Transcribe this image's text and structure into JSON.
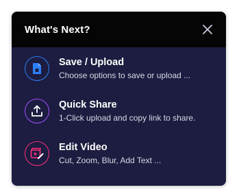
{
  "dialog": {
    "title": "What's Next?",
    "close_icon": "close-icon"
  },
  "options": [
    {
      "title": "Save / Upload",
      "description": "Choose options to save or upload ...",
      "icon": "file-save-icon",
      "accent": "#2d7ff9"
    },
    {
      "title": "Quick Share",
      "description": "1-Click upload and copy link to share.",
      "icon": "upload-share-icon",
      "accent": "#a64dff"
    },
    {
      "title": "Edit Video",
      "description": "Cut, Zoom, Blur, Add Text ...",
      "icon": "video-edit-icon",
      "accent": "#ff2f7d"
    }
  ],
  "colors": {
    "panel_background": "#1c1d40",
    "header_background": "#050505",
    "text_primary": "#ffffff"
  }
}
